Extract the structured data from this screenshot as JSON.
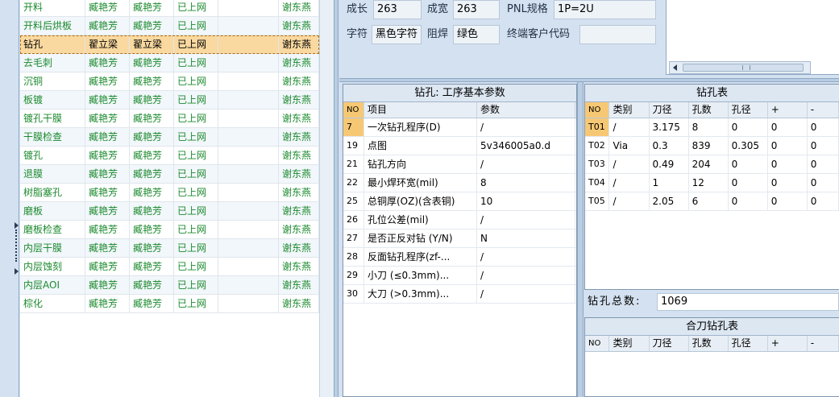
{
  "task_list": {
    "rows": [
      [
        "开料",
        "臧艳芳",
        "臧艳芳",
        "已上网",
        "",
        "谢东燕"
      ],
      [
        "开料后烘板",
        "臧艳芳",
        "臧艳芳",
        "已上网",
        "",
        "谢东燕"
      ],
      [
        "钻孔",
        "翟立梁",
        "翟立梁",
        "已上网",
        "",
        "谢东燕"
      ],
      [
        "去毛刺",
        "臧艳芳",
        "臧艳芳",
        "已上网",
        "",
        "谢东燕"
      ],
      [
        "沉铜",
        "臧艳芳",
        "臧艳芳",
        "已上网",
        "",
        "谢东燕"
      ],
      [
        "板镀",
        "臧艳芳",
        "臧艳芳",
        "已上网",
        "",
        "谢东燕"
      ],
      [
        "镀孔干膜",
        "臧艳芳",
        "臧艳芳",
        "已上网",
        "",
        "谢东燕"
      ],
      [
        "干膜检查",
        "臧艳芳",
        "臧艳芳",
        "已上网",
        "",
        "谢东燕"
      ],
      [
        "镀孔",
        "臧艳芳",
        "臧艳芳",
        "已上网",
        "",
        "谢东燕"
      ],
      [
        "退膜",
        "臧艳芳",
        "臧艳芳",
        "已上网",
        "",
        "谢东燕"
      ],
      [
        "树脂塞孔",
        "臧艳芳",
        "臧艳芳",
        "已上网",
        "",
        "谢东燕"
      ],
      [
        "磨板",
        "臧艳芳",
        "臧艳芳",
        "已上网",
        "",
        "谢东燕"
      ],
      [
        "磨板检查",
        "臧艳芳",
        "臧艳芳",
        "已上网",
        "",
        "谢东燕"
      ],
      [
        "内层干膜",
        "臧艳芳",
        "臧艳芳",
        "已上网",
        "",
        "谢东燕"
      ],
      [
        "内层蚀刻",
        "臧艳芳",
        "臧艳芳",
        "已上网",
        "",
        "谢东燕"
      ],
      [
        "内层AOI",
        "臧艳芳",
        "臧艳芳",
        "已上网",
        "",
        "谢东燕"
      ],
      [
        "棕化",
        "臧艳芳",
        "臧艳芳",
        "已上网",
        "",
        "谢东燕"
      ]
    ]
  },
  "info": {
    "growth_label": "成长",
    "growth_value": "263",
    "width_label": "成宽",
    "width_value": "263",
    "pnl_label": "PNL规格",
    "pnl_value": "1P=2U",
    "char_label": "字符",
    "char_value": "黑色字符",
    "mask_label": "阻焊",
    "mask_value": "绿色",
    "customer_label": "终端客户代码",
    "customer_value": ""
  },
  "param_table": {
    "title": "钻孔: 工序基本参数",
    "headers": [
      "NO",
      "项目",
      "参数"
    ],
    "rows": [
      [
        "7",
        "一次钻孔程序(D)",
        "/"
      ],
      [
        "19",
        "点图",
        "5v346005a0.d"
      ],
      [
        "21",
        "钻孔方向",
        "/"
      ],
      [
        "22",
        "最小焊环宽(mil)",
        "8"
      ],
      [
        "25",
        "总铜厚(OZ)(含表铜)",
        "10"
      ],
      [
        "26",
        "孔位公差(mil)",
        "/"
      ],
      [
        "27",
        "是否正反对钻 (Y/N)",
        "N"
      ],
      [
        "28",
        "反面钻孔程序(zf-...",
        "/"
      ],
      [
        "29",
        "小刀 (≤0.3mm)...",
        "/"
      ],
      [
        "30",
        "大刀 (>0.3mm)...",
        "/"
      ]
    ]
  },
  "drill_table": {
    "title": "钻孔表",
    "headers": [
      "NO",
      "类别",
      "刀径",
      "孔数",
      "孔径",
      "+",
      "-"
    ],
    "rows": [
      [
        "T01",
        "/",
        "3.175",
        "8",
        "0",
        "0",
        "0"
      ],
      [
        "T02",
        "Via",
        "0.3",
        "839",
        "0.305",
        "0",
        "0"
      ],
      [
        "T03",
        "/",
        "0.49",
        "204",
        "0",
        "0",
        "0"
      ],
      [
        "T04",
        "/",
        "1",
        "12",
        "0",
        "0",
        "0"
      ],
      [
        "T05",
        "/",
        "2.05",
        "6",
        "0",
        "0",
        "0"
      ]
    ]
  },
  "total": {
    "label": "钻孔总数:",
    "value": "1069"
  },
  "combo_table": {
    "title": "合刀钻孔表",
    "headers": [
      "NO",
      "类别",
      "刀径",
      "孔数",
      "孔径",
      "+",
      "-"
    ]
  }
}
